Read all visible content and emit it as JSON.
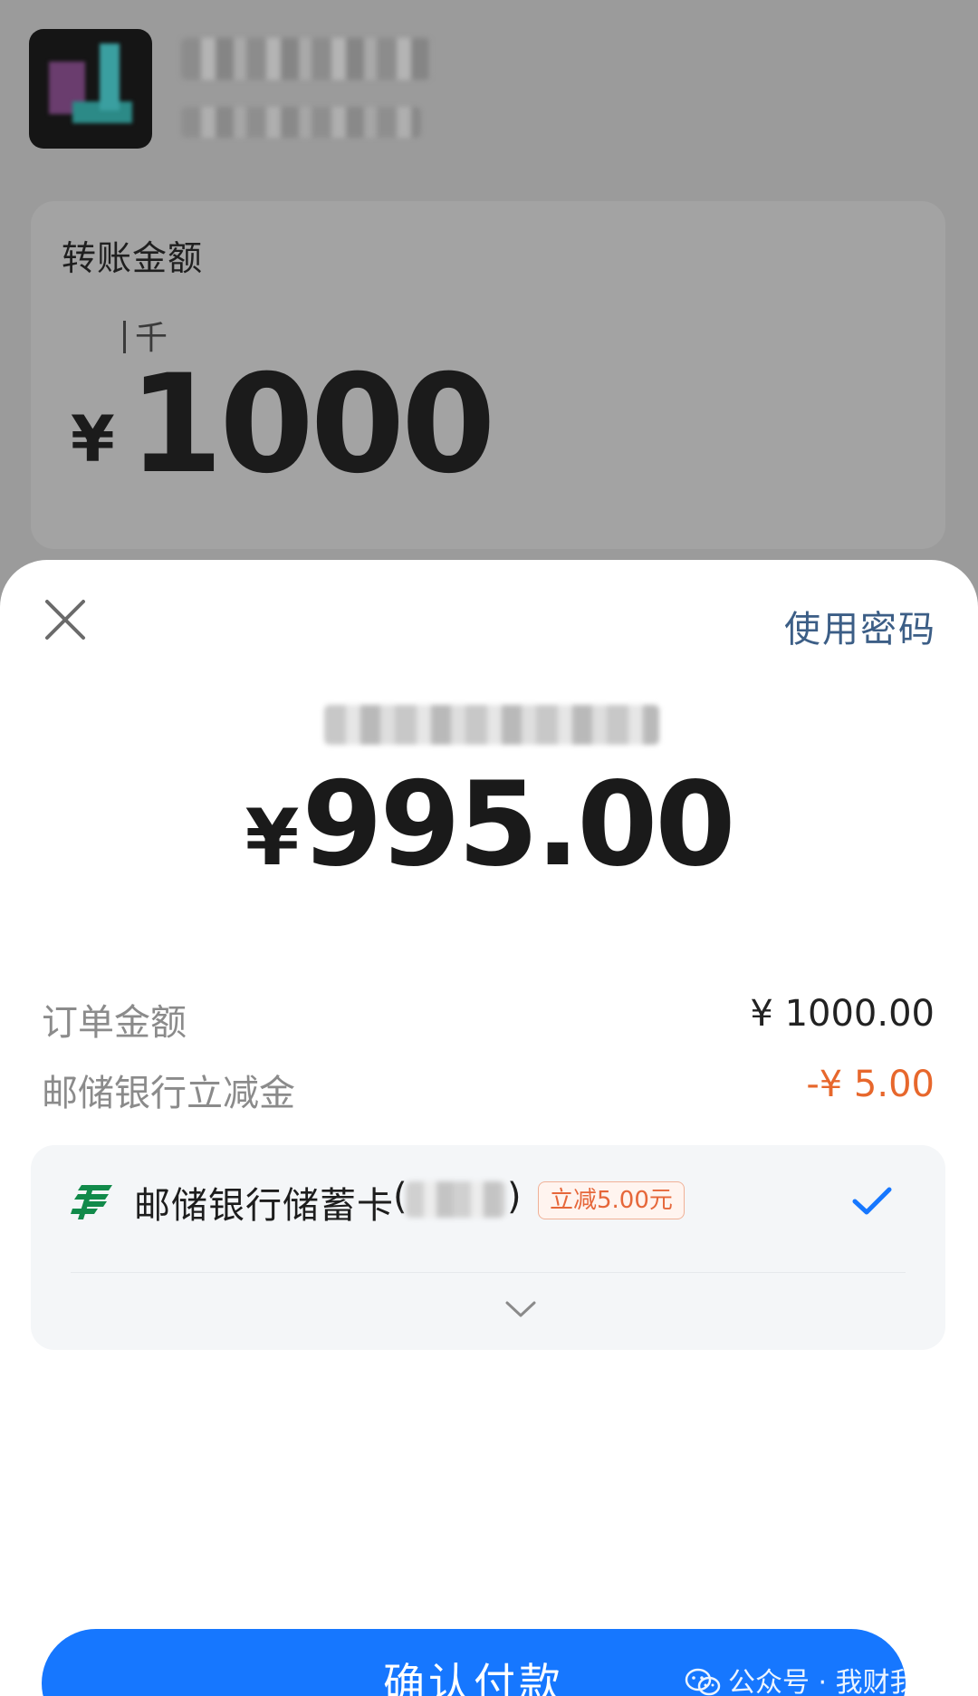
{
  "background": {
    "amount_card": {
      "label": "转账金额",
      "unit_hint": "千",
      "currency_symbol": "¥",
      "amount": "1000"
    }
  },
  "sheet": {
    "use_password_label": "使用密码",
    "pay_amount": {
      "currency_symbol": "¥",
      "value": "995.00"
    },
    "order_row": {
      "label": "订单金额",
      "value": "¥ 1000.00"
    },
    "discount_row": {
      "label": "邮储银行立减金",
      "value": "-¥ 5.00"
    },
    "payment_method": {
      "bank_name": "邮储银行储蓄卡",
      "paren_open": "(",
      "paren_close": ")",
      "promo_tag": "立减5.00元",
      "selected": true
    },
    "confirm_button_label": "确认付款",
    "watermark": "公众号 · 我财我"
  },
  "colors": {
    "primary_button": "#1677ff",
    "discount_text": "#e7672c",
    "link_text": "#3c5e86",
    "bank_logo_green": "#118a4a",
    "check_blue": "#1677ff"
  },
  "icons": [
    "close-icon",
    "bank-logo-icon",
    "check-icon",
    "chevron-down-icon",
    "wechat-icon"
  ]
}
